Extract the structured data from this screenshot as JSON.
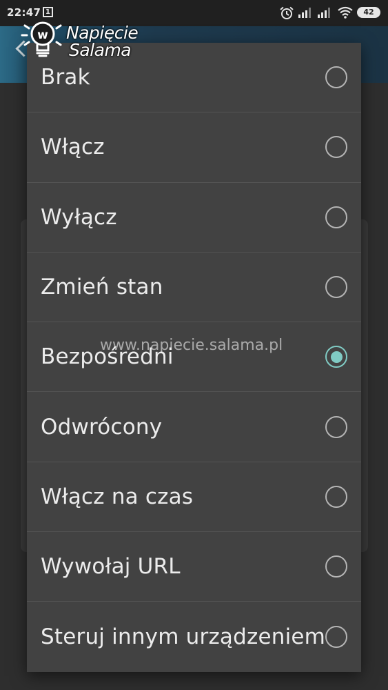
{
  "status_bar": {
    "time": "22:47",
    "notification_badge": "1",
    "battery": "42",
    "icons": [
      "alarm-icon",
      "signal-icon",
      "signal-icon",
      "wifi-icon",
      "battery-icon"
    ]
  },
  "watermark": {
    "logo_line1": "Napięcie",
    "logo_line2": "Salama",
    "url": "www.napiecie.salama.pl"
  },
  "dialog": {
    "selected_index": 4,
    "accent_color": "#80cbc4",
    "options": [
      {
        "label": "Brak",
        "selected": false
      },
      {
        "label": "Włącz",
        "selected": false
      },
      {
        "label": "Wyłącz",
        "selected": false
      },
      {
        "label": "Zmień stan",
        "selected": false
      },
      {
        "label": "Bezpośredni",
        "selected": true
      },
      {
        "label": "Odwrócony",
        "selected": false
      },
      {
        "label": "Włącz na czas",
        "selected": false
      },
      {
        "label": "Wywołaj URL",
        "selected": false
      },
      {
        "label": "Steruj innym urządzeniem",
        "selected": false
      }
    ]
  }
}
